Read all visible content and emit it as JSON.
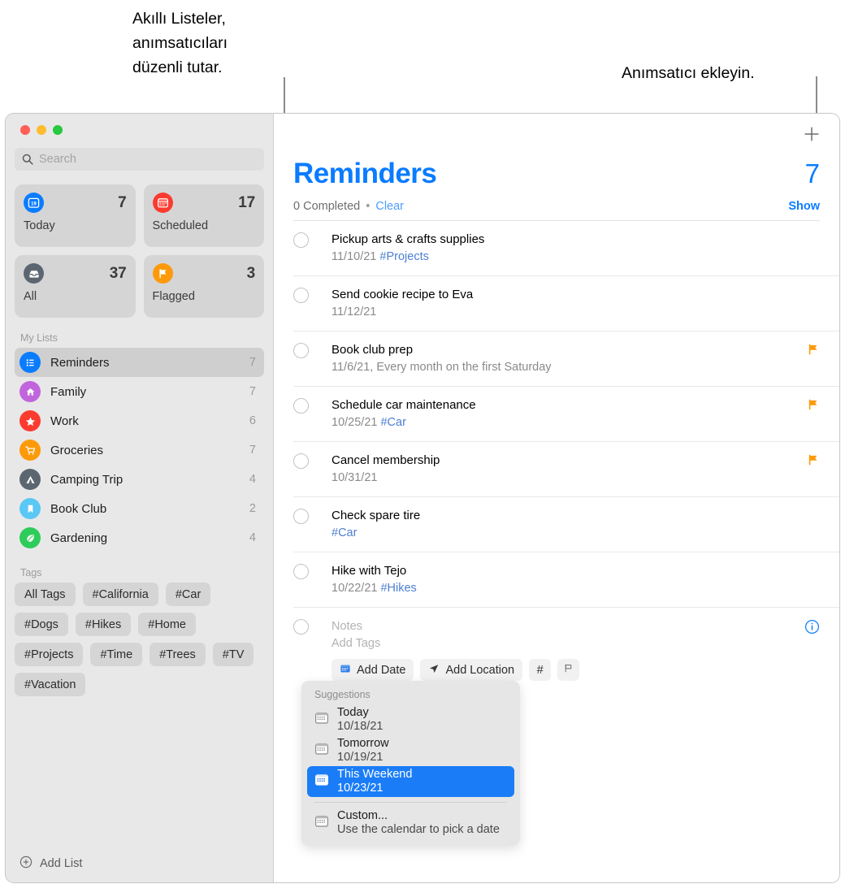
{
  "callouts": {
    "left": "Akıllı Listeler,\nanımsatıcıları\ndüzenli tutar.",
    "right": "Anımsatıcı ekleyin."
  },
  "sidebar": {
    "search": {
      "placeholder": "Search",
      "icon": "search-icon"
    },
    "smart_lists": [
      {
        "label": "Today",
        "count": "7",
        "icon": "calendar-day-icon",
        "color": "#0a7cff"
      },
      {
        "label": "Scheduled",
        "count": "17",
        "icon": "calendar-icon",
        "color": "#fc3b30"
      },
      {
        "label": "All",
        "count": "37",
        "icon": "inbox-icon",
        "color": "#5b6670"
      },
      {
        "label": "Flagged",
        "count": "3",
        "icon": "flag-icon",
        "color": "#fd9a0b"
      }
    ],
    "my_lists_header": "My Lists",
    "lists": [
      {
        "label": "Reminders",
        "count": "7",
        "icon": "bullet-list-icon",
        "color": "#0a7cff",
        "selected": true
      },
      {
        "label": "Family",
        "count": "7",
        "icon": "house-icon",
        "color": "#c165dd",
        "selected": false
      },
      {
        "label": "Work",
        "count": "6",
        "icon": "star-icon",
        "color": "#fc3b30",
        "selected": false
      },
      {
        "label": "Groceries",
        "count": "7",
        "icon": "cart-icon",
        "color": "#fd9a0b",
        "selected": false
      },
      {
        "label": "Camping Trip",
        "count": "4",
        "icon": "tent-icon",
        "color": "#5b6670",
        "selected": false
      },
      {
        "label": "Book Club",
        "count": "2",
        "icon": "bookmark-icon",
        "color": "#5ac8f5",
        "selected": false
      },
      {
        "label": "Gardening",
        "count": "4",
        "icon": "leaf-icon",
        "color": "#2ecc5a",
        "selected": false
      }
    ],
    "tags_header": "Tags",
    "tags": [
      "All Tags",
      "#California",
      "#Car",
      "#Dogs",
      "#Hikes",
      "#Home",
      "#Projects",
      "#Time",
      "#Trees",
      "#TV",
      "#Vacation"
    ],
    "add_list": {
      "label": "Add List",
      "icon": "plus-circle-icon"
    }
  },
  "main": {
    "add_button_icon": "plus-icon",
    "title": "Reminders",
    "count": "7",
    "completed_text": "0 Completed",
    "separator_dot": "•",
    "clear_label": "Clear",
    "show_label": "Show",
    "accent_color": "#0a7cff",
    "reminders": [
      {
        "title": "Pickup arts & crafts supplies",
        "date": "11/10/21",
        "tag": "#Projects",
        "flagged": false
      },
      {
        "title": "Send cookie recipe to Eva",
        "date": "11/12/21",
        "tag": "",
        "flagged": false
      },
      {
        "title": "Book club prep",
        "date": "11/6/21, Every month on the first Saturday",
        "tag": "",
        "flagged": true
      },
      {
        "title": "Schedule car maintenance",
        "date": "10/25/21",
        "tag": "#Car",
        "flagged": true
      },
      {
        "title": "Cancel membership",
        "date": "10/31/21",
        "tag": "",
        "flagged": true
      },
      {
        "title": "Check spare tire",
        "date": "",
        "tag": "#Car",
        "flagged": false
      },
      {
        "title": "Hike with Tejo",
        "date": "10/22/21",
        "tag": "#Hikes",
        "flagged": false
      }
    ],
    "new_reminder": {
      "notes_placeholder": "Notes",
      "tags_placeholder": "Add Tags",
      "info_icon": "info-circle-icon",
      "chips": [
        {
          "label": "Add Date",
          "icon": "calendar-icon"
        },
        {
          "label": "Add Location",
          "icon": "location-arrow-icon"
        },
        {
          "label": "#",
          "icon": "hash-icon"
        },
        {
          "label": "",
          "icon": "flag-outline-icon"
        }
      ]
    }
  },
  "suggestions": {
    "header": "Suggestions",
    "items": [
      {
        "title": "Today",
        "sub": "10/18/21",
        "icon": "calendar-icon",
        "selected": false
      },
      {
        "title": "Tomorrow",
        "sub": "10/19/21",
        "icon": "calendar-icon",
        "selected": false
      },
      {
        "title": "This Weekend",
        "sub": "10/23/21",
        "icon": "calendar-icon",
        "selected": true
      },
      {
        "title": "Custom...",
        "sub": "Use the calendar to pick a date",
        "icon": "calendar-icon",
        "selected": false
      }
    ],
    "highlight_color": "#1a7df7"
  }
}
